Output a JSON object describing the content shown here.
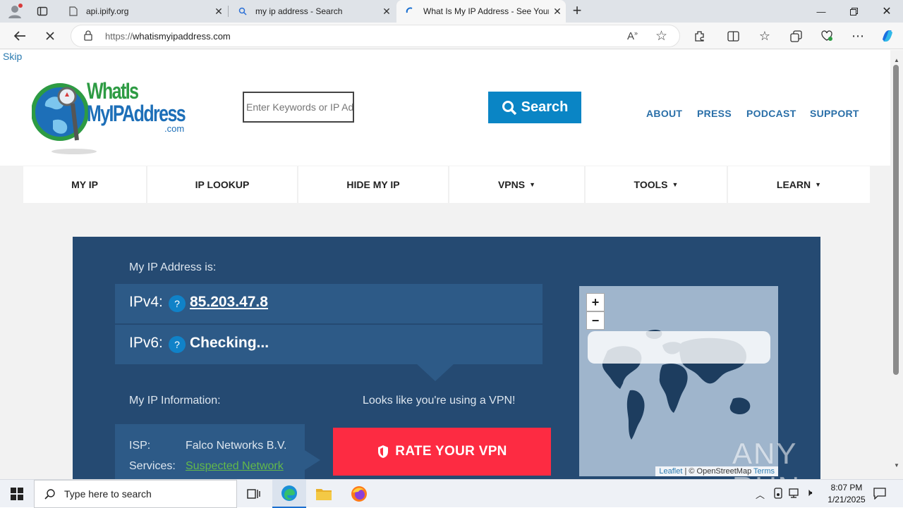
{
  "browser": {
    "tabs": [
      {
        "label": "api.ipify.org",
        "icon": "document-icon"
      },
      {
        "label": "my ip address - Search",
        "icon": "search-icon"
      },
      {
        "label": "What Is My IP Address - See Your",
        "icon": "loading-icon",
        "active": true
      }
    ],
    "url_protocol": "https://",
    "url_host": "whatismyipaddress.com"
  },
  "page": {
    "skip_label": "Skip",
    "logo": {
      "line1": "WhatIs",
      "line2": "MyIPAddress",
      "line3": ".com"
    },
    "search_placeholder": "Enter Keywords or IP Address",
    "search_button": "Search",
    "top_links": [
      "ABOUT",
      "PRESS",
      "PODCAST",
      "SUPPORT"
    ],
    "main_nav": [
      {
        "label": "MY IP",
        "dropdown": false
      },
      {
        "label": "IP LOOKUP",
        "dropdown": false
      },
      {
        "label": "HIDE MY IP",
        "dropdown": false
      },
      {
        "label": "VPNS",
        "dropdown": true
      },
      {
        "label": "TOOLS",
        "dropdown": true
      },
      {
        "label": "LEARN",
        "dropdown": true
      }
    ],
    "ip_heading": "My IP Address is:",
    "ipv4_label": "IPv4:",
    "ipv4_value": "85.203.47.8",
    "ipv6_label": "IPv6:",
    "ipv6_value": "Checking...",
    "help_mark": "?",
    "info_heading": "My IP Information:",
    "vpn_notice": "Looks like you're using a VPN!",
    "isp_label": "ISP:",
    "isp_value": "Falco Networks B.V.",
    "services_label": "Services:",
    "services_value": "Suspected Network",
    "rate_button": "RATE YOUR VPN",
    "map": {
      "zoom_in": "+",
      "zoom_out": "−",
      "attrib_leaflet": "Leaflet",
      "attrib_osm": "| © OpenStreetMap",
      "attrib_terms": "Terms"
    },
    "watermark": "ANY RUN"
  },
  "taskbar": {
    "search_placeholder": "Type here to search",
    "time": "8:07 PM",
    "date": "1/21/2025"
  },
  "colors": {
    "panel": "#254a72",
    "panel_row": "#2d5a87",
    "accent_blue": "#0a85c5",
    "rate_red": "#fd2b42",
    "link_green": "#63b94a"
  }
}
